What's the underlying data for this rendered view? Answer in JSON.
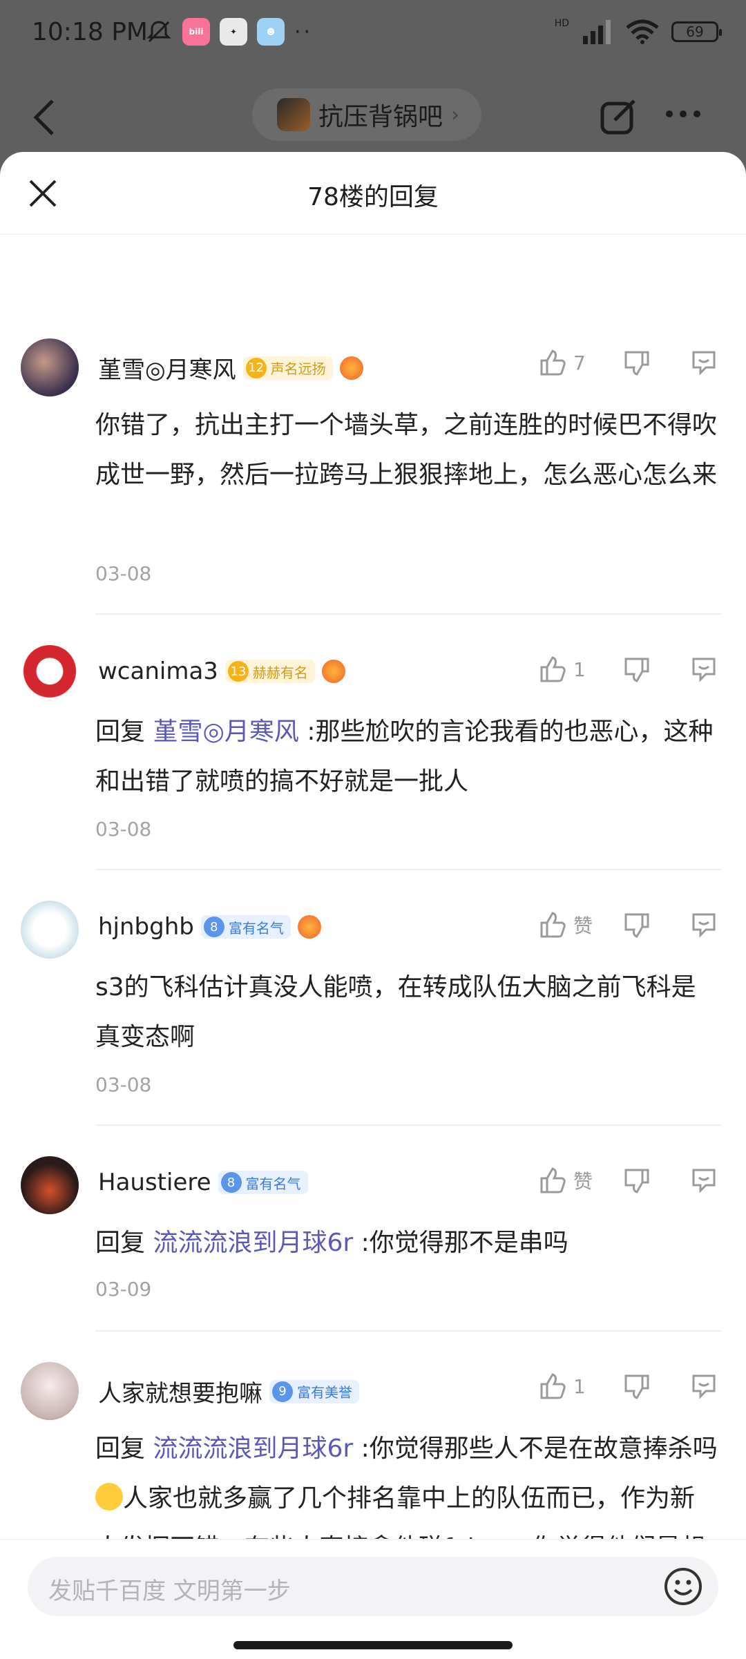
{
  "status": {
    "time": "10:18 PM",
    "app_icons": [
      "bilibili",
      "app",
      "app"
    ],
    "network": "HD",
    "battery": "69"
  },
  "topnav": {
    "forum_name": "抗压背锅吧"
  },
  "sheet": {
    "title": "78楼的回复"
  },
  "replies": [
    {
      "user": "堇雪◎月寒风",
      "level": "12",
      "level_title": "声名远扬",
      "level_style": "gold",
      "game_badge": true,
      "likes": "7",
      "text": "你错了，抗出主打一个墙头草，之前连胜的时候巴不得吹成世一野，然后一拉跨马上狠狠摔地上，怎么恶心怎么来",
      "date": "03-08"
    },
    {
      "user": "wcanima3",
      "level": "13",
      "level_title": "赫赫有名",
      "level_style": "gold",
      "game_badge": true,
      "likes": "1",
      "reply_prefix": "回复",
      "mention": "堇雪◎月寒风",
      "text": ":那些尬吹的言论我看的也恶心，这种和出错了就喷的搞不好就是一批人",
      "date": "03-08"
    },
    {
      "user": "hjnbghb",
      "level": "8",
      "level_title": "富有名气",
      "level_style": "blue",
      "game_badge": true,
      "likes": "赞",
      "text": "s3的飞科估计真没人能喷，在转成队伍大脑之前飞科是真变态啊",
      "date": "03-08"
    },
    {
      "user": "Haustiere",
      "level": "8",
      "level_title": "富有名气",
      "level_style": "blue",
      "game_badge": false,
      "likes": "赞",
      "reply_prefix": "回复",
      "mention": "流流流浪到月球6r",
      "text": ":你觉得那不是串吗",
      "date": "03-09"
    },
    {
      "user": "人家就想要抱嘛",
      "level": "9",
      "level_title": "富有美誉",
      "level_style": "blue",
      "game_badge": false,
      "likes": "1",
      "reply_prefix": "回复",
      "mention": "流流流浪到月球6r",
      "text_a": ":你觉得那些人不是在故意捧杀吗 ",
      "text_b": "人家也就多赢了几个排名靠中上的队伍而已，作为新人发挥不错。有些人直接拿他碰faker，你觉得他们是想让他好还是想让他去",
      "keycap": "4"
    }
  ],
  "input": {
    "placeholder": "发贴千百度 文明第一步"
  }
}
